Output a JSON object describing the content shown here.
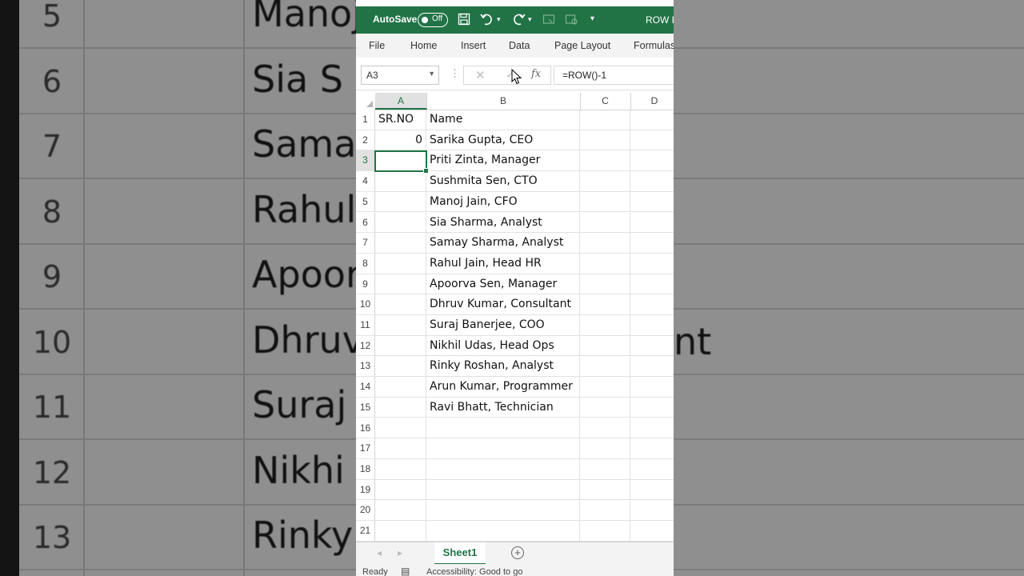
{
  "background": {
    "row_numbers": [
      "5",
      "6",
      "7",
      "8",
      "9",
      "10",
      "11",
      "12",
      "13"
    ],
    "names": [
      "Manoj",
      "Sia S",
      "Samay",
      "Rahul",
      "Apoor",
      "Dhruv",
      "Suraj",
      "Nikhi",
      "Rinky"
    ],
    "right_fragment": "nt"
  },
  "titlebar": {
    "autosave_label": "AutoSave",
    "toggle_state": "Off",
    "document_title": "ROW F"
  },
  "ribbon_tabs": [
    "File",
    "Home",
    "Insert",
    "Data",
    "Page Layout",
    "Formulas"
  ],
  "formula_bar": {
    "name_box": "A3",
    "cancel_glyph": "✕",
    "enter_glyph": "✓",
    "fx_label": "fx",
    "formula": "=ROW()-1"
  },
  "columns": [
    "A",
    "B",
    "C",
    "D"
  ],
  "rows": [
    {
      "n": "1",
      "a": "SR.NO",
      "b": "Name"
    },
    {
      "n": "2",
      "a": "0",
      "b": "Sarika Gupta, CEO"
    },
    {
      "n": "3",
      "a": "",
      "b": "Priti Zinta, Manager"
    },
    {
      "n": "4",
      "a": "",
      "b": "Sushmita Sen, CTO"
    },
    {
      "n": "5",
      "a": "",
      "b": "Manoj Jain, CFO"
    },
    {
      "n": "6",
      "a": "",
      "b": "Sia Sharma, Analyst"
    },
    {
      "n": "7",
      "a": "",
      "b": "Samay Sharma, Analyst"
    },
    {
      "n": "8",
      "a": "",
      "b": "Rahul Jain, Head HR"
    },
    {
      "n": "9",
      "a": "",
      "b": "Apoorva Sen, Manager"
    },
    {
      "n": "10",
      "a": "",
      "b": "Dhruv Kumar, Consultant"
    },
    {
      "n": "11",
      "a": "",
      "b": "Suraj Banerjee, COO"
    },
    {
      "n": "12",
      "a": "",
      "b": "Nikhil Udas, Head Ops"
    },
    {
      "n": "13",
      "a": "",
      "b": "Rinky Roshan, Analyst"
    },
    {
      "n": "14",
      "a": "",
      "b": "Arun Kumar, Programmer"
    },
    {
      "n": "15",
      "a": "",
      "b": "Ravi Bhatt, Technician"
    },
    {
      "n": "16",
      "a": "",
      "b": ""
    },
    {
      "n": "17",
      "a": "",
      "b": ""
    },
    {
      "n": "18",
      "a": "",
      "b": ""
    },
    {
      "n": "19",
      "a": "",
      "b": ""
    },
    {
      "n": "20",
      "a": "",
      "b": ""
    },
    {
      "n": "21",
      "a": "",
      "b": ""
    }
  ],
  "active_cell": "A3",
  "sheet_tab": "Sheet1",
  "status": {
    "ready": "Ready",
    "accessibility": "Accessibility: Good to go"
  },
  "colors": {
    "excel_green": "#217346"
  }
}
